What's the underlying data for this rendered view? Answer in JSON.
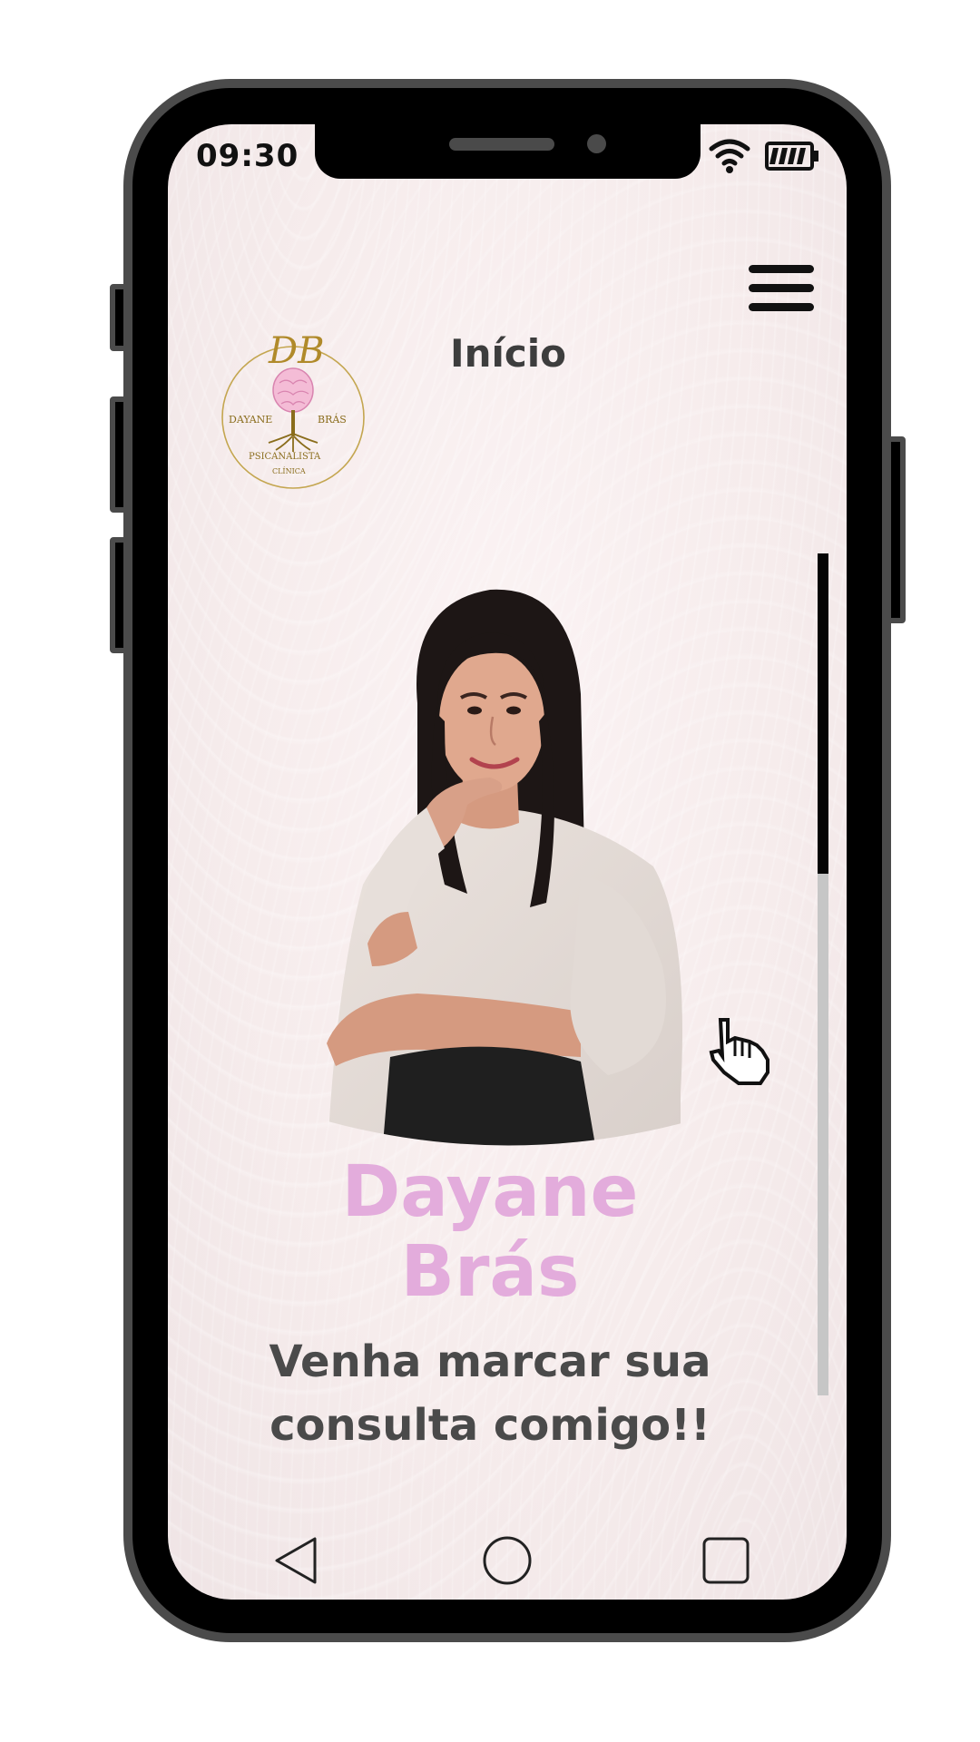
{
  "status_bar": {
    "time": "09:30",
    "wifi_icon": "wifi-icon",
    "battery_icon": "battery-icon"
  },
  "header": {
    "title": "Início",
    "menu_icon": "hamburger-menu-icon"
  },
  "logo": {
    "monogram": "DB",
    "name_left": "DAYANE",
    "name_right": "BRÁS",
    "subtitle": "PSICANALISTA",
    "subtitle2": "CLÍNICA",
    "color": "#b08a2a"
  },
  "hero": {
    "name_line1": "Dayane",
    "name_line2": "Brás",
    "tagline_line1": "Venha marcar sua",
    "tagline_line2": "consulta comigo!!",
    "name_color": "#e3acdc",
    "tagline_color": "#4a4a4a"
  },
  "scrollbar": {
    "position_fraction": 0.38
  },
  "nav": {
    "back_icon": "triangle-back-icon",
    "home_icon": "circle-home-icon",
    "recent_icon": "square-recent-icon"
  }
}
